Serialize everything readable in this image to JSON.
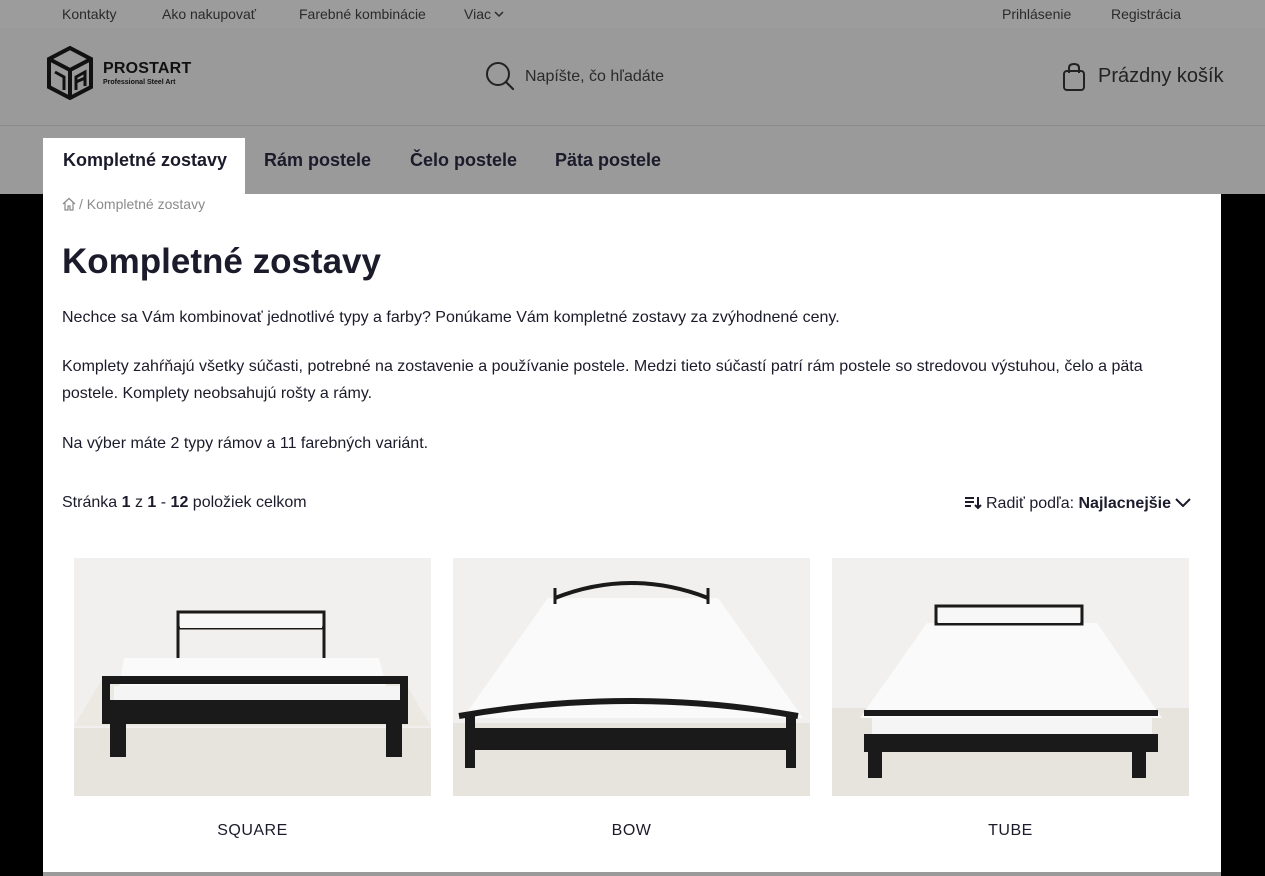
{
  "topbar": {
    "left_links": [
      "Kontakty",
      "Ako nakupovať",
      "Farebné kombinácie",
      "Viac"
    ],
    "right_links": [
      "Prihlásenie",
      "Registrácia"
    ]
  },
  "header": {
    "brand": "PROSTART",
    "tagline": "Professional Steel Art",
    "search_placeholder": "Napíšte, čo hľadáte",
    "cart_label": "Prázdny košík"
  },
  "categories": [
    "Kompletné zostavy",
    "Rám postele",
    "Čelo postele",
    "Päta postele"
  ],
  "breadcrumb": {
    "separator": "/",
    "current": "Kompletné zostavy"
  },
  "page": {
    "title": "Kompletné zostavy",
    "paragraphs": [
      "Nechce sa Vám kombinovať jednotlivé typy a farby? Ponúkame Vám kompletné zostavy za zvýhodnené ceny.",
      "Komplety zahŕňajú všetky súčasti, potrebné na zostavenie a používanie postele. Medzi tieto súčastí patrí rám postele so stredovou výstuhou, čelo a päta postele. Komplety neobsahujú rošty a rámy.",
      "Na výber máte 2 typy rámov a 11 farebných variánt."
    ]
  },
  "pager": {
    "prefix": "Stránka",
    "page": "1",
    "of": "z",
    "from": "1",
    "dash": "-",
    "to": "12",
    "suffix": "položiek celkom"
  },
  "sort": {
    "label": "Radiť podľa:",
    "value": "Najlacnejšie"
  },
  "products": [
    {
      "name": "SQUARE",
      "style": "square"
    },
    {
      "name": "BOW",
      "style": "bow"
    },
    {
      "name": "TUBE",
      "style": "tube"
    }
  ]
}
